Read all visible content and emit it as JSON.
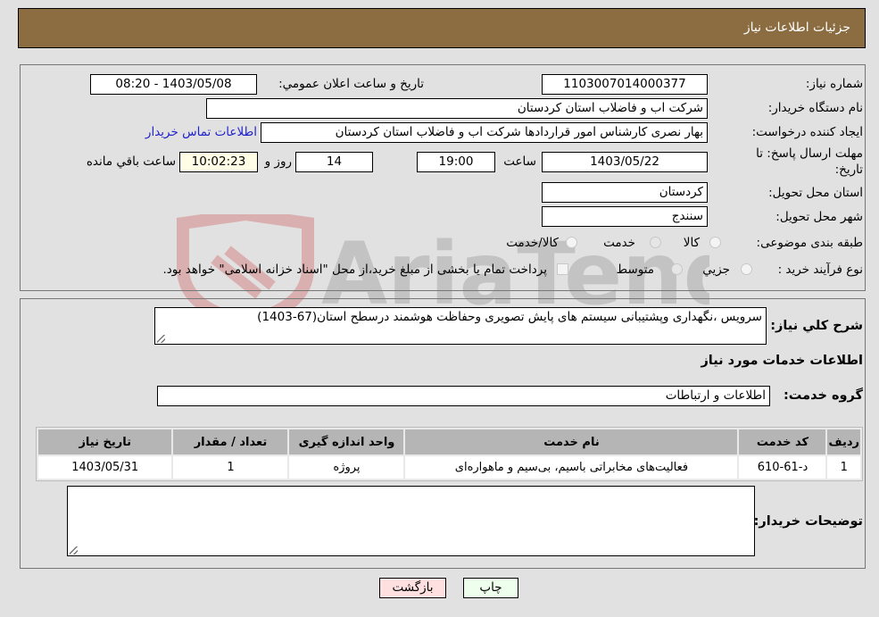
{
  "header": {
    "title": "جزئيات اطلاعات نياز"
  },
  "form": {
    "need_number": {
      "label": "شماره نیاز:",
      "value": "1103007014000377"
    },
    "announce_datetime": {
      "label": "تاريخ و ساعت اعلان عمومي:",
      "value": "1403/05/08 - 08:20"
    },
    "buyer_org": {
      "label": "نام دستگاه خریدار:",
      "value": "شرکت اب و فاضلاب استان کردستان"
    },
    "requester": {
      "label": "ایجاد کننده درخواست:",
      "value": "بهار نصری کارشناس امور قراردادها شرکت اب و فاضلاب استان کردستان"
    },
    "contact_link": "اطلاعات تماس خریدار",
    "deadline": {
      "label_line1": "مهلت ارسال پاسخ: تا",
      "label_line2": "تاریخ:",
      "date": "1403/05/22",
      "time_label": "ساعت",
      "time": "19:00",
      "days": "14",
      "days_label": "روز و",
      "remaining": "10:02:23",
      "remaining_label": "ساعت باقي مانده"
    },
    "province": {
      "label": "استان محل تحویل:",
      "value": "کردستان"
    },
    "city": {
      "label": "شهر محل تحویل:",
      "value": "سنندج"
    },
    "category": {
      "label": "طبقه بندی موضوعی:",
      "options": [
        "کالا",
        "خدمت",
        "کالا/خدمت"
      ],
      "selected": "خدمت"
    },
    "process_type": {
      "label": "نوع فرآیند خرید :",
      "options": [
        "جزيي",
        "متوسط"
      ],
      "selected": "متوسط",
      "treasury_note": "پرداخت تمام یا بخشی از مبلغ خرید،از محل \"اسناد خزانه اسلامی\" خواهد بود."
    }
  },
  "description": {
    "label": "شرح کلي نياز:",
    "value": "سرویس ،نگهداری وپشتیبانی سیستم های پایش تصویری وحفاظت هوشمند درسطح استان(67-1403)"
  },
  "services": {
    "section_title": "اطلاعات خدمات مورد نياز",
    "group_label": "گروه خدمت:",
    "group_value": "اطلاعات و ارتباطات",
    "table": {
      "headers": [
        "رديف",
        "کد خدمت",
        "نام خدمت",
        "واحد اندازه گيری",
        "تعداد / مقدار",
        "تاريخ نياز"
      ],
      "rows": [
        [
          "1",
          "د-61-610",
          "فعالیت‌های مخابراتی باسیم، بی‌سیم و ماهواره‌ای",
          "پروژه",
          "1",
          "1403/05/31"
        ]
      ]
    }
  },
  "buyer_notes": {
    "label": "توضيحات خريدار:",
    "value": ""
  },
  "buttons": {
    "print": "چاپ",
    "back": "بازگشت"
  },
  "watermark": {
    "text": "AriaTender.neT"
  }
}
